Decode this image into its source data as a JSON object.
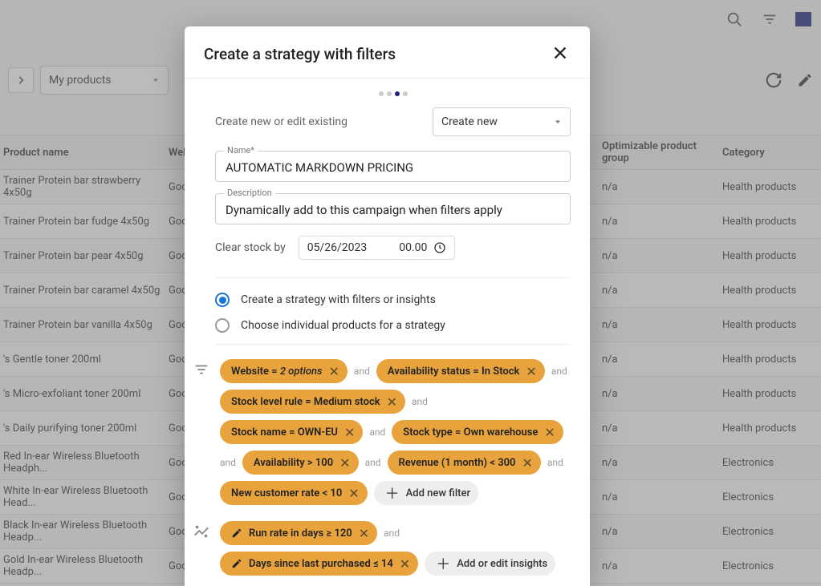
{
  "topbar": {
    "flag": "flag"
  },
  "toolbar": {
    "dropdown": "My products"
  },
  "table": {
    "headers": {
      "name": "Product name",
      "web": "Website",
      "opt": "Optimizable product group",
      "cat": "Category"
    },
    "rows": [
      {
        "name": "Trainer Protein bar strawberry 4x50g",
        "web": "Goo...",
        "opt": "n/a",
        "cat": "Health products"
      },
      {
        "name": "Trainer Protein bar fudge 4x50g",
        "web": "Goo...",
        "opt": "n/a",
        "cat": "Health products"
      },
      {
        "name": "Trainer Protein bar pear 4x50g",
        "web": "Goo...",
        "opt": "n/a",
        "cat": "Health products"
      },
      {
        "name": "Trainer Protein bar caramel 4x50g",
        "web": "Goo...",
        "opt": "n/a",
        "cat": "Health products"
      },
      {
        "name": "Trainer Protein bar vanilla 4x50g",
        "web": "Goo...",
        "opt": "n/a",
        "cat": "Health products"
      },
      {
        "name": "'s Gentle toner 200ml",
        "web": "Goo...",
        "opt": "n/a",
        "cat": "Health products"
      },
      {
        "name": "'s Micro-exfoliant toner 200ml",
        "web": "Goo...",
        "opt": "n/a",
        "cat": "Health products"
      },
      {
        "name": "'s Daily purifying toner 200ml",
        "web": "Goo...",
        "opt": "n/a",
        "cat": "Health products"
      },
      {
        "name": "Red In-ear Wireless Bluetooth Headph...",
        "web": "Goo...",
        "opt": "n/a",
        "cat": "Electronics"
      },
      {
        "name": "White In-ear Wireless Bluetooth Head...",
        "web": "Goo...",
        "opt": "n/a",
        "cat": "Electronics"
      },
      {
        "name": "Black In-ear Wireless Bluetooth Headp...",
        "web": "Goo...",
        "opt": "n/a",
        "cat": "Electronics"
      },
      {
        "name": "Gold In-ear Wireless Bluetooth Headp...",
        "web": "Goo...",
        "opt": "n/a",
        "cat": "Electronics"
      }
    ]
  },
  "modal": {
    "title": "Create a strategy with filters",
    "create_label": "Create new or edit existing",
    "create_value": "Create new",
    "name_legend": "Name*",
    "name_value": "AUTOMATIC MARKDOWN PRICING",
    "desc_legend": "Description",
    "desc_value": "Dynamically add to this campaign when filters apply",
    "clear_label": "Clear stock by",
    "clear_date": "05/26/2023",
    "clear_time": "00.00",
    "radio1": "Create a strategy with filters or insights",
    "radio2": "Choose individual products for a strategy",
    "and": "and",
    "add_filter": "Add new filter",
    "add_insight": "Add or edit insights",
    "filters": {
      "f1a": "Website = ",
      "f1b": "2 options",
      "f2": "Availability status = In Stock",
      "f3": "Stock level rule = Medium stock",
      "f4": "Stock name = OWN-EU",
      "f5": "Stock type = Own warehouse",
      "f6": "Availability > 100",
      "f7": "Revenue (1 month) < 300",
      "f8": "New customer rate < 10"
    },
    "insights": {
      "i1": "Run rate in days ≥ 120",
      "i2": "Days since last purchased ≤ 14"
    }
  }
}
